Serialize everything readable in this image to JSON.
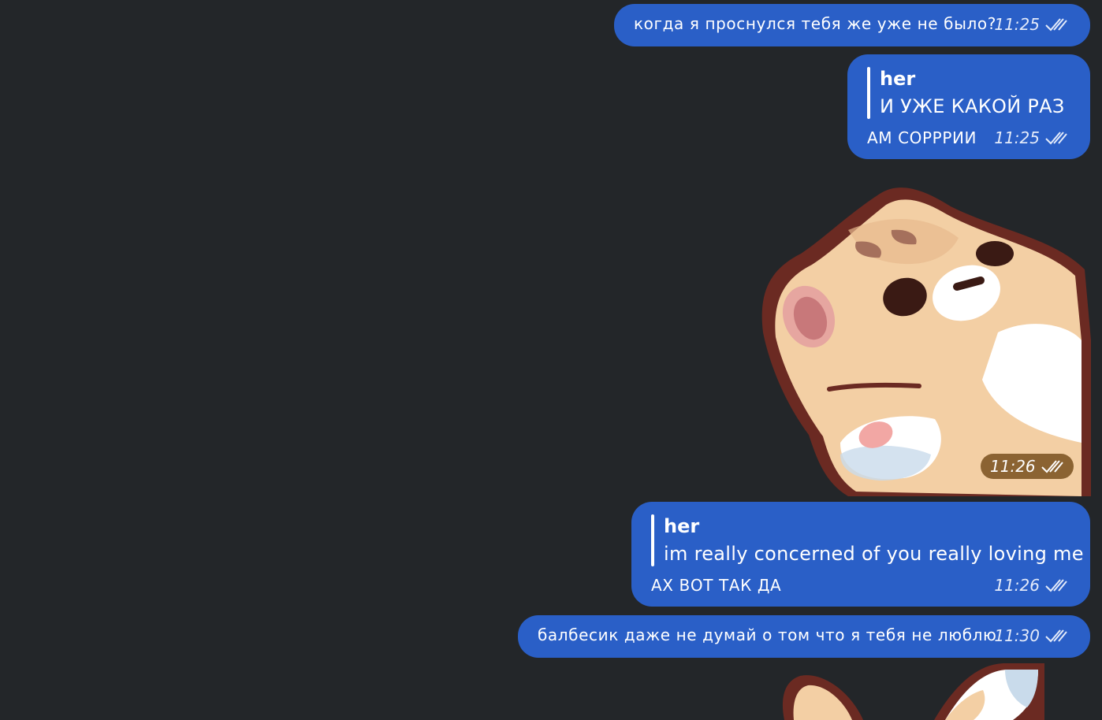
{
  "messages": [
    {
      "text": "когда я проснулся тебя же уже не было?",
      "time": "11:25",
      "status_icon": "double-check-icon"
    },
    {
      "reply": {
        "author": "her",
        "text": "И УЖЕ КАКОЙ РАЗ"
      },
      "text": "АМ СОРРРИИ",
      "time": "11:25",
      "status_icon": "double-check-icon"
    },
    {
      "sticker": "cat-sticker",
      "time": "11:26",
      "status_icon": "double-check-icon"
    },
    {
      "reply": {
        "author": "her",
        "text": "im really concerned of you really loving me"
      },
      "text": "АХ ВОТ ТАК ДА",
      "time": "11:26",
      "status_icon": "double-check-icon"
    },
    {
      "text": "балбесик даже не думай о том что я тебя не люблю",
      "time": "11:30",
      "status_icon": "double-check-icon"
    },
    {
      "sticker": "cat-sticker"
    }
  ],
  "colors": {
    "background": "#232629",
    "outgoing_bubble": "#2a5fc7",
    "sticker_outline": "#6b2a22",
    "cat_fur": "#f3cfa4"
  }
}
